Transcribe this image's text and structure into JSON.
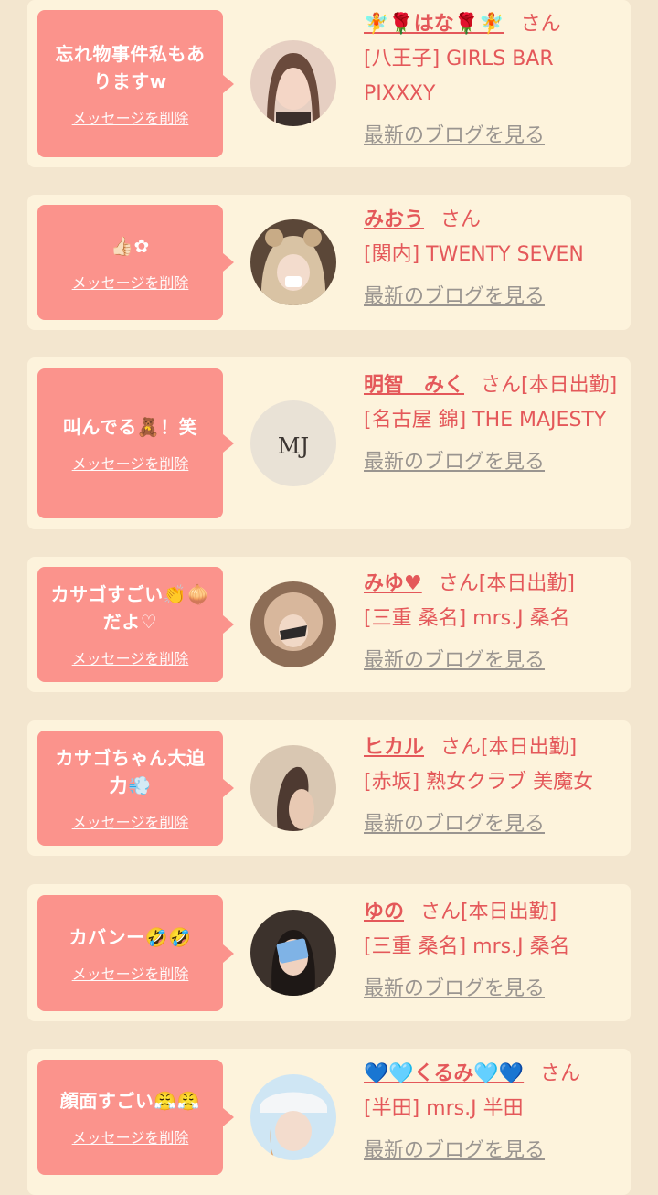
{
  "delete_label": "メッセージを削除",
  "blog_label": "最新のブログを見る",
  "entries": [
    {
      "message": "忘れ物事件私もありますw",
      "name": "🧚🌹はな🌹🧚",
      "suffix": "さん",
      "shop": "[八王子] GIRLS BAR PIXXXY"
    },
    {
      "message": "👍🏻✿",
      "name": "みおう",
      "suffix": "さん",
      "shop": "[関内] TWENTY SEVEN"
    },
    {
      "message": "叫んでる🧸！笑",
      "name": "明智　みく",
      "suffix": "さん[本日出勤]",
      "shop": "[名古屋 錦] THE MAJESTY"
    },
    {
      "message": "カサゴすごい👏🧅だよ♡",
      "name": "みゆ♥",
      "suffix": "さん[本日出勤]",
      "shop": "[三重 桑名] mrs.J 桑名"
    },
    {
      "message": "カサゴちゃん大迫力💨",
      "name": "ヒカル",
      "suffix": "さん[本日出勤]",
      "shop": "[赤坂] 熟女クラブ 美魔女"
    },
    {
      "message": "カバンー🤣🤣",
      "name": "ゆの",
      "suffix": "さん[本日出勤]",
      "shop": "[三重 桑名] mrs.J 桑名"
    },
    {
      "message": "顔面すごい😤😤",
      "name": "💙🩵くるみ🩵💙",
      "suffix": "さん",
      "shop": "[半田] mrs.J 半田"
    }
  ],
  "avatar_seal_text": "MJ"
}
